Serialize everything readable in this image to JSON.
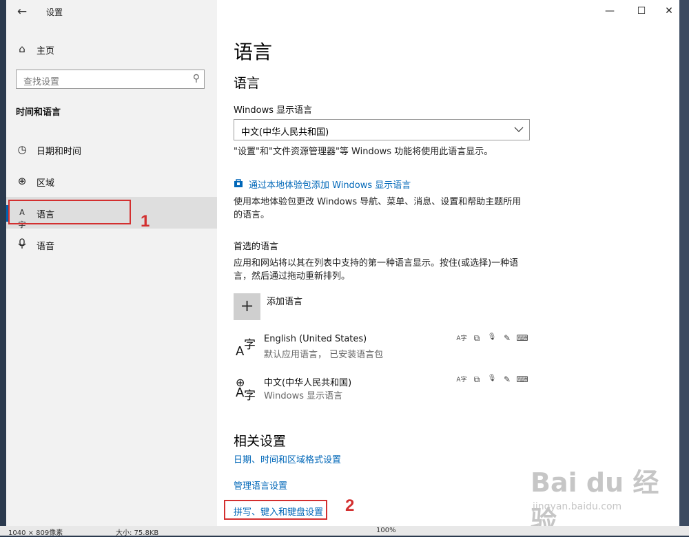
{
  "window": {
    "title": "设置",
    "back_icon": "←",
    "controls": {
      "minimize": "—",
      "maximize": "☐",
      "close": "✕"
    }
  },
  "sidebar": {
    "home_label": "主页",
    "search_placeholder": "查找设置",
    "section_title": "时间和语言",
    "items": [
      {
        "label": "日期和时间",
        "icon": "calendar-clock-icon",
        "glyph": "◷"
      },
      {
        "label": "区域",
        "icon": "globe-icon",
        "glyph": "⊕"
      },
      {
        "label": "语言",
        "icon": "language-icon",
        "glyph": "A字",
        "active": true
      },
      {
        "label": "语音",
        "icon": "microphone-icon",
        "glyph": "🎙"
      }
    ]
  },
  "annotations": {
    "first": "1",
    "second": "2",
    "color": "#d32f2f"
  },
  "main": {
    "page_title": "语言",
    "section_language": "语言",
    "display_language_label": "Windows 显示语言",
    "display_language_value": "中文(中华人民共和国)",
    "display_language_desc": "\"设置\"和\"文件资源管理器\"等 Windows 功能将使用此语言显示。",
    "store_link": "通过本地体验包添加 Windows 显示语言",
    "store_desc_line1": "使用本地体验包更改 Windows 导航、菜单、消息、设置和帮助主题所用",
    "store_desc_line2": "的语言。",
    "preferred_title": "首选的语言",
    "preferred_desc_line1": "应用和网站将以其在列表中支持的第一种语言显示。按住(或选择)一种语",
    "preferred_desc_line2": "言，然后通过拖动重新排列。",
    "add_language": "添加语言",
    "languages": [
      {
        "name": "English (United States)",
        "sub": "默认应用语言， 已安装语言包"
      },
      {
        "name": "中文(中华人民共和国)",
        "sub": "Windows 显示语言"
      }
    ],
    "feature_icons": [
      "A字",
      "⧉",
      "🎙",
      "✎",
      "⌨"
    ],
    "related_title": "相关设置",
    "related_links": [
      "日期、时间和区域格式设置",
      "管理语言设置",
      "拼写、键入和键盘设置"
    ]
  },
  "statusbar": {
    "dims": "1040 × 809像素",
    "size": "大小: 75.8KB",
    "zoom": "100%"
  },
  "watermark": {
    "brand": "Bai du 经验",
    "url": "jingyan.baidu.com"
  },
  "colors": {
    "accent": "#0067b8",
    "active_bar": "#0063b1",
    "annotation": "#d32f2f"
  }
}
